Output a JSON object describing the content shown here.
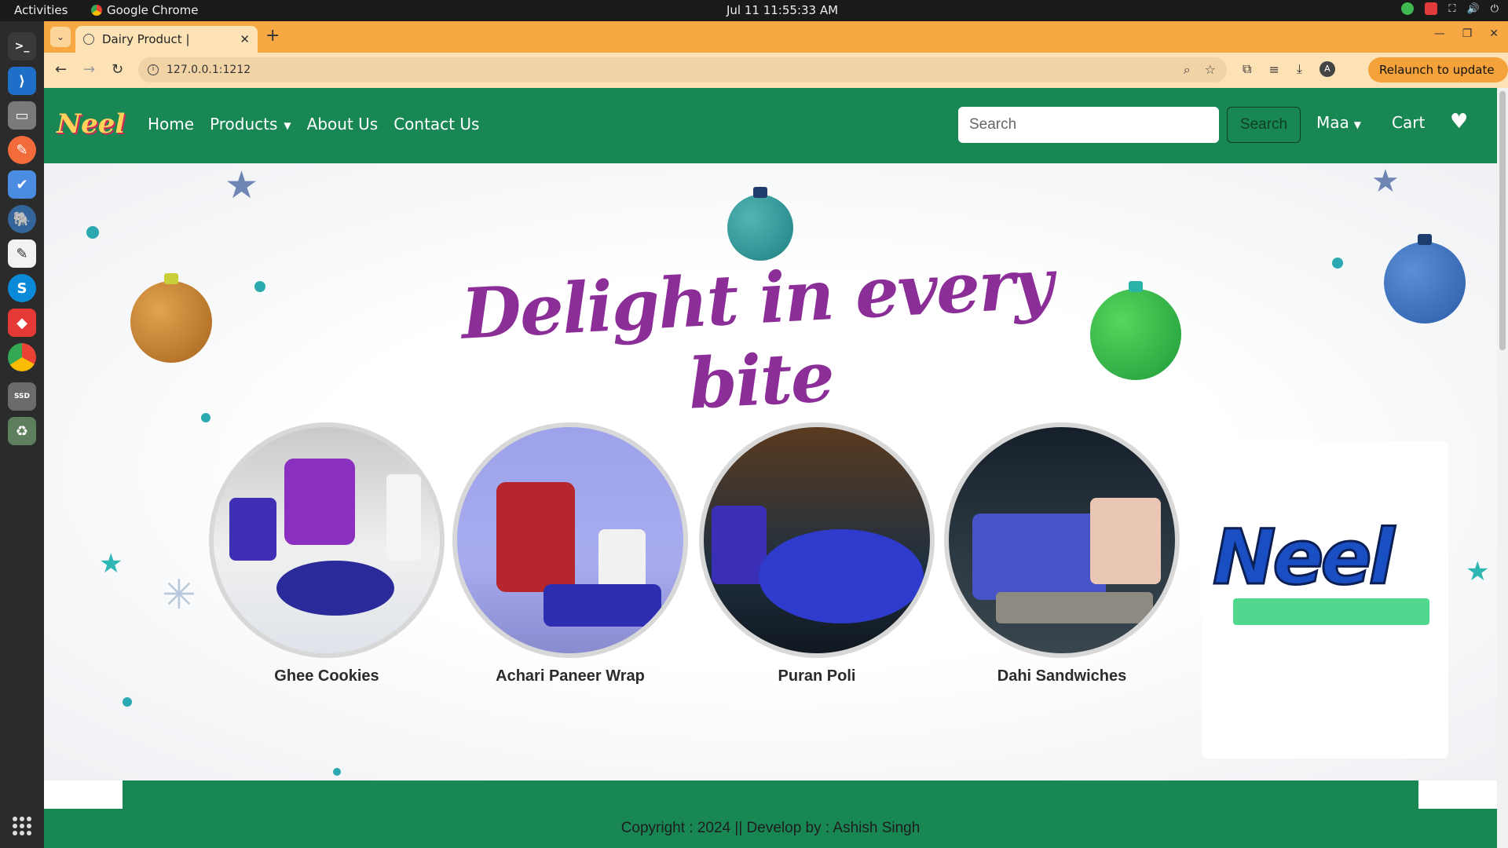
{
  "system": {
    "activities": "Activities",
    "app_name": "Google Chrome",
    "clock": "Jul 11  11:55:33 AM"
  },
  "browser": {
    "tab_title": "Dairy Product |",
    "url": "127.0.0.1:1212",
    "relaunch_label": "Relaunch to update",
    "profile_initial": "A",
    "theme_color": "#f7a843"
  },
  "navbar": {
    "brand": "Neel",
    "links": [
      "Home",
      "Products",
      "About Us",
      "Contact Us"
    ],
    "search_placeholder": "Search",
    "search_button": "Search",
    "user_menu": "Maa",
    "cart": "Cart",
    "background": "#198754"
  },
  "hero": {
    "headline": "Delight in every bite",
    "dishes": [
      {
        "name": "Ghee Cookies"
      },
      {
        "name": "Achari Paneer Wrap"
      },
      {
        "name": "Puran Poli"
      },
      {
        "name": "Dahi Sandwiches"
      }
    ],
    "logo": "Neel"
  },
  "footer": {
    "copyright": "Copyright : 2024 || Develop by : Ashish Singh"
  }
}
